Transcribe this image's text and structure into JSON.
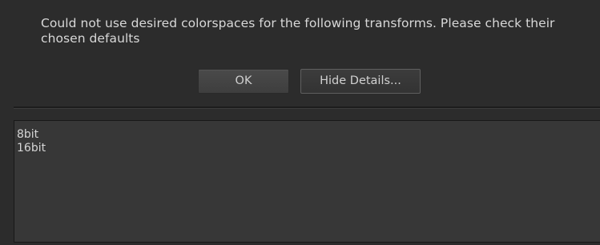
{
  "dialog": {
    "message": "Could not use desired colorspaces for the following transforms. Please check their chosen defaults",
    "ok_label": "OK",
    "details_toggle_label": "Hide Details...",
    "details_lines": [
      "8bit",
      "16bit"
    ]
  },
  "colors": {
    "background": "#2c2c2c",
    "text": "#d8d8d8",
    "details_background": "#373737"
  }
}
